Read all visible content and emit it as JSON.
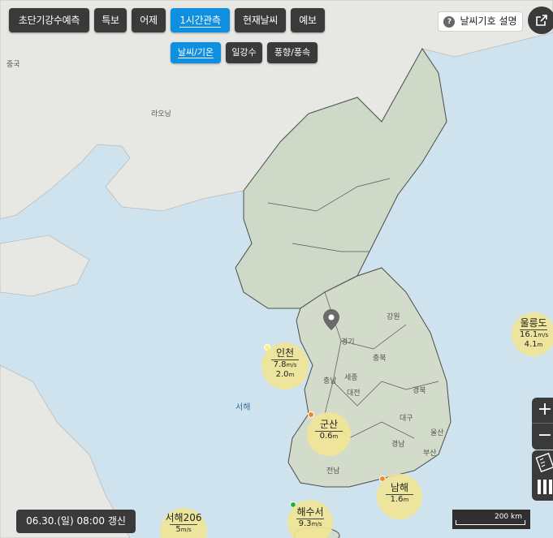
{
  "nav": {
    "tabs": [
      {
        "label": "초단기강수예측"
      },
      {
        "label": "특보"
      },
      {
        "label": "어제"
      },
      {
        "label": "1시간관측"
      },
      {
        "label": "현재날씨"
      },
      {
        "label": "예보"
      }
    ],
    "subtabs": [
      {
        "label": "날씨/기온"
      },
      {
        "label": "일강수"
      },
      {
        "label": "풍향/풍속"
      }
    ],
    "legend_label": "날씨기호 설명",
    "legend_icon": "?"
  },
  "map_labels": {
    "china": "중국",
    "liaoning": "라오닝",
    "yellow_sea": "서해",
    "gangwon": "강원",
    "gyeonggi": "경기",
    "chungbuk": "충북",
    "chungnam": "충남",
    "sejong": "세종",
    "daejeon": "대전",
    "gyeongbuk": "경북",
    "daegu": "대구",
    "ulsan": "울산",
    "gyeongnam": "경남",
    "busan": "부산",
    "jeonnam": "전남"
  },
  "stations": [
    {
      "name": "인천",
      "wave_speed": "7.8",
      "speed_unit": "m/s",
      "wave_height": "2.0",
      "height_unit": "m",
      "dot_color": "#fff27a"
    },
    {
      "name": "군산",
      "wave_speed": "0.6",
      "speed_unit": "",
      "wave_height": "",
      "height_unit": "m",
      "dot_color": "#f08a2c"
    },
    {
      "name": "울릉도",
      "wave_speed": "16.1",
      "speed_unit": "m/s",
      "wave_height": "4.1",
      "height_unit": "m",
      "dot_color": "#ffffff"
    },
    {
      "name": "남해",
      "wave_speed": "1.6",
      "speed_unit": "m",
      "wave_height": "",
      "height_unit": "",
      "dot_color": "#f08a2c"
    },
    {
      "name": "해수서",
      "wave_speed": "9.3",
      "speed_unit": "m/s",
      "wave_height": "",
      "height_unit": "",
      "dot_color": "#22b04a"
    },
    {
      "name": "서해206",
      "wave_speed": "5",
      "speed_unit": "m/s",
      "wave_height": "",
      "height_unit": "",
      "dot_color": "#ffffff"
    }
  ],
  "timestamp": "06.30.(일) 08:00 갱신",
  "zoom": {
    "in": "+",
    "out": "−"
  },
  "scale_label": "200 km",
  "colors": {
    "active": "#0f8fe0",
    "button": "#3a3a3a",
    "sea": "#cfe3ee",
    "land": "#e7e7e4",
    "korea": "#cfd9c8"
  }
}
